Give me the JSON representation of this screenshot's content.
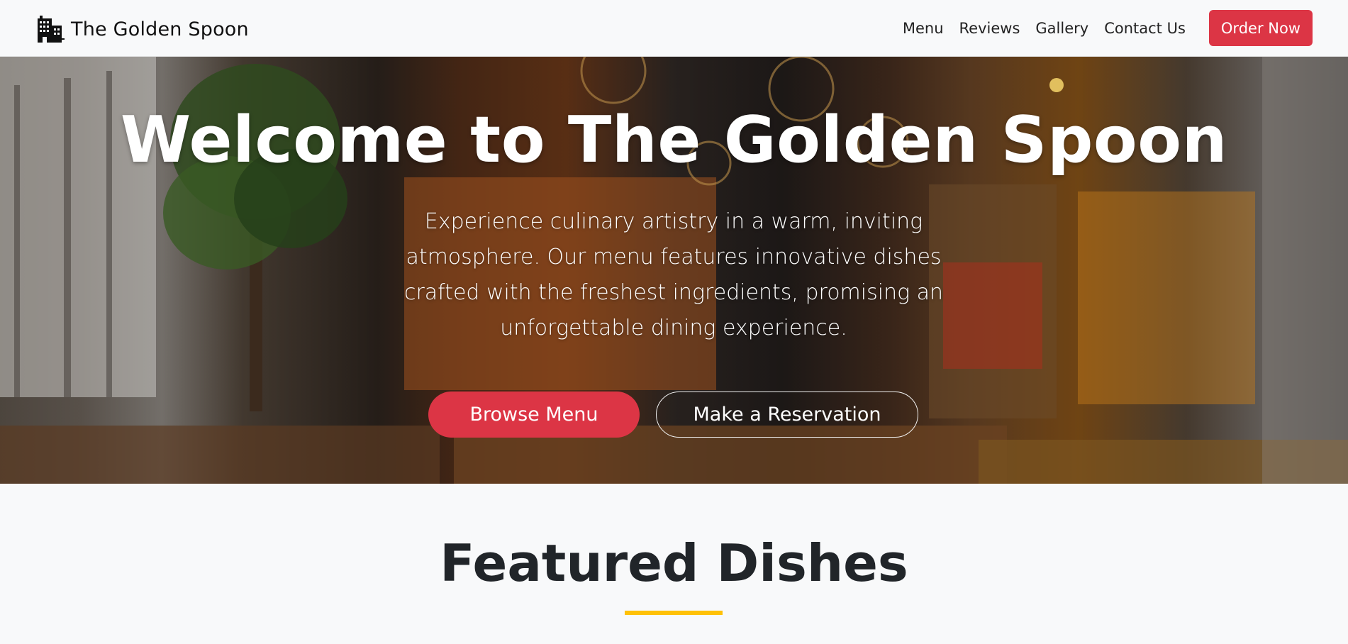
{
  "navbar": {
    "brand_icon": "building-icon",
    "brand_name": "The Golden Spoon",
    "links": [
      "Menu",
      "Reviews",
      "Gallery",
      "Contact Us"
    ],
    "cta_label": "Order Now"
  },
  "hero": {
    "title": "Welcome to The Golden Spoon",
    "description": "Experience culinary artistry in a warm, inviting atmosphere. Our menu features innovative dishes crafted with the freshest ingredients, promising an unforgettable dining experience.",
    "primary_button": "Browse Menu",
    "secondary_button": "Make a Reservation"
  },
  "featured": {
    "title": "Featured Dishes"
  },
  "colors": {
    "accent_red": "#dc3545",
    "accent_gold": "#ffc107",
    "navbar_bg": "#f8f9fa",
    "heading_dark": "#212529"
  }
}
